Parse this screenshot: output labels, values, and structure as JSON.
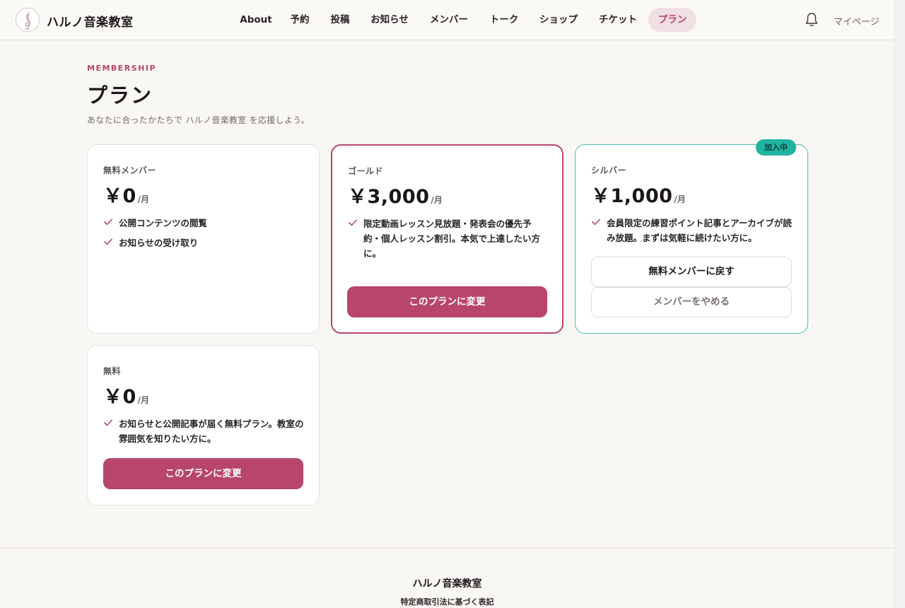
{
  "header": {
    "brand": "ハルノ音楽教室",
    "nav": [
      {
        "label": "About"
      },
      {
        "label": "予約"
      },
      {
        "label": "投稿"
      },
      {
        "label": "お知らせ"
      },
      {
        "label": "メンバー"
      },
      {
        "label": "トーク"
      },
      {
        "label": "ショップ"
      },
      {
        "label": "チケット"
      },
      {
        "label": "プラン",
        "active": true
      }
    ],
    "mypage": "マイページ",
    "icons": {
      "logo": "treble-clef-icon",
      "notifications": "bell-icon"
    }
  },
  "page": {
    "eyebrow": "MEMBERSHIP",
    "title": "プラン",
    "subtitle": "あなたに合ったかたちで ハルノ音楽教室 を応援しよう。"
  },
  "plans": [
    {
      "name": "無料メンバー",
      "price": "￥0",
      "unit": "/月",
      "features": [
        "公開コンテンツの閲覧",
        "お知らせの受け取り"
      ]
    },
    {
      "name": "ゴールド",
      "price": "￥3,000",
      "unit": "/月",
      "features": [
        "限定動画レッスン見放題・発表会の優先予約・個人レッスン割引。本気で上達したい方に。"
      ],
      "button": "このプランに変更"
    },
    {
      "name": "シルバー",
      "price": "￥1,000",
      "unit": "/月",
      "badge": "加入中",
      "features": [
        "会員限定の練習ポイント記事とアーカイブが読み放題。まずは気軽に続けたい方に。"
      ],
      "button_back": "無料メンバーに戻す",
      "button_cancel": "メンバーをやめる"
    },
    {
      "name": "無料",
      "price": "￥0",
      "unit": "/月",
      "features": [
        "お知らせと公開記事が届く無料プラン。教室の雰囲気を知りたい方に。"
      ],
      "button": "このプランに変更"
    }
  ],
  "footer": {
    "brand": "ハルノ音楽教室",
    "link": "特定商取引法に基づく表記"
  },
  "colors": {
    "accent": "#b8466b",
    "accent_soft": "#f1dfe3",
    "current_plan": "#1fb4a0",
    "background": "#f9f7f4"
  }
}
